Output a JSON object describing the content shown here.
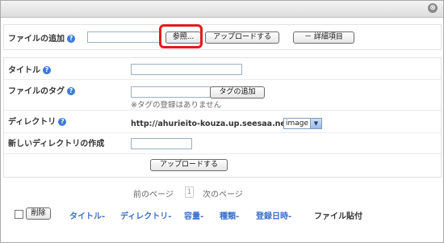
{
  "titlebar": {
    "close_glyph": "⊗"
  },
  "add_file": {
    "label": "ファイルの追加",
    "browse_button": "参照...",
    "upload_button": "アップロードする",
    "details_button": "－ 詳細項目"
  },
  "form": {
    "title_label": "タイトル",
    "tag_label": "ファイルのタグ",
    "add_tag_button": "タグの追加",
    "tag_note": "※タグの登録はありません",
    "directory_label": "ディレクトリ",
    "directory_url": "http://ahurieito-kouza.up.seesaa.net/",
    "directory_select": "image",
    "new_dir_label": "新しいディレクトリの作成",
    "upload_button": "アップロードする"
  },
  "pager": {
    "prev": "前のページ",
    "current": "1",
    "next": "次のページ"
  },
  "table": {
    "delete_button": "削除",
    "headers": [
      "タイトル-",
      "ディレクトリ-",
      "容量-",
      "種類-",
      "登録日時-",
      "ファイル貼付"
    ]
  },
  "colors": {
    "highlight": "#e31b1b",
    "link": "#3a6fc7",
    "help_icon": "#3c7ad6"
  }
}
